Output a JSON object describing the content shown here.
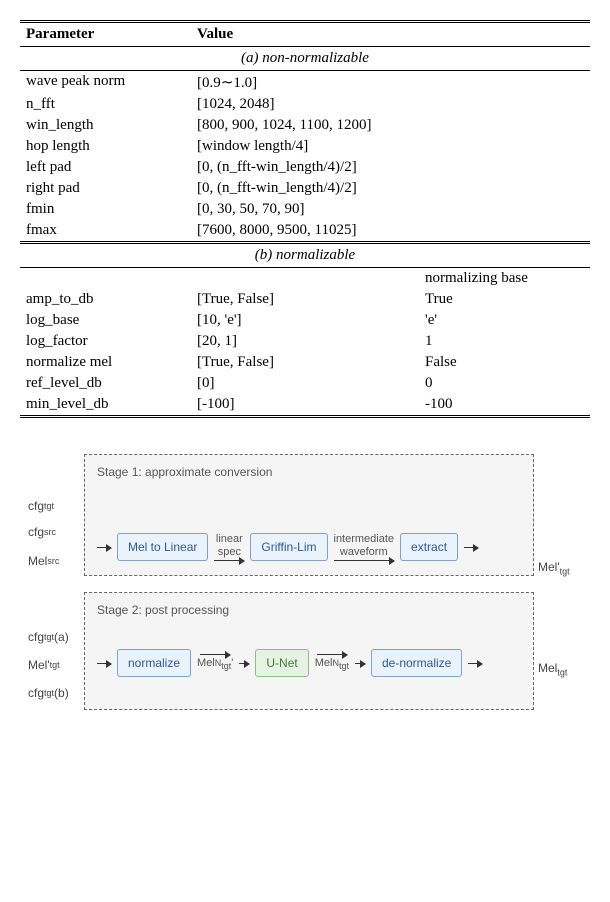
{
  "table": {
    "headers": {
      "param": "Parameter",
      "value": "Value"
    },
    "sections": {
      "a": {
        "title": "(a) non-normalizable",
        "rows": [
          {
            "param": "wave peak norm",
            "value": "[0.9∼1.0]"
          },
          {
            "param": "n_fft",
            "value": "[1024, 2048]"
          },
          {
            "param": "win_length",
            "value": "[800, 900, 1024, 1100, 1200]"
          },
          {
            "param": "hop length",
            "value": "[window length/4]"
          },
          {
            "param": "left pad",
            "value": "[0, (n_fft-win_length/4)/2]"
          },
          {
            "param": "right pad",
            "value": "[0, (n_fft-win_length/4)/2]"
          },
          {
            "param": "fmin",
            "value": "[0, 30, 50, 70, 90]"
          },
          {
            "param": "fmax",
            "value": "[7600, 8000, 9500, 11025]"
          }
        ]
      },
      "b": {
        "title": "(b) normalizable",
        "base_header": "normalizing base",
        "rows": [
          {
            "param": "amp_to_db",
            "value": "[True, False]",
            "base": "True"
          },
          {
            "param": "log_base",
            "value": "[10, 'e']",
            "base": "'e'"
          },
          {
            "param": "log_factor",
            "value": "[20, 1]",
            "base": "1"
          },
          {
            "param": "normalize mel",
            "value": "[True, False]",
            "base": "False"
          },
          {
            "param": "ref_level_db",
            "value": "[0]",
            "base": "0"
          },
          {
            "param": "min_level_db",
            "value": "[-100]",
            "base": "-100"
          }
        ]
      }
    }
  },
  "diagram": {
    "stage1": {
      "title": "Stage 1: approximate conversion",
      "inputs": {
        "cfg_tgt": "cfg",
        "cfg_src": "cfg",
        "mel_src": "Mel"
      },
      "nodes": {
        "mel2lin": "Mel to Linear",
        "gl": "Griffin-Lim",
        "extract": "extract"
      },
      "edges": {
        "linspec": "linear\nspec",
        "iw": "intermediate\nwaveform"
      },
      "output": "Mel'"
    },
    "stage2": {
      "title": "Stage 2: post processing",
      "inputs": {
        "cfg_tgt_a": "cfg",
        "melp_tgt": "Mel'",
        "cfg_tgt_b": "cfg"
      },
      "nodes": {
        "norm": "normalize",
        "unet": "U-Net",
        "denorm": "de-normalize"
      },
      "edges": {
        "meln_p": "Mel",
        "meln": "Mel"
      },
      "output": "Mel"
    }
  }
}
